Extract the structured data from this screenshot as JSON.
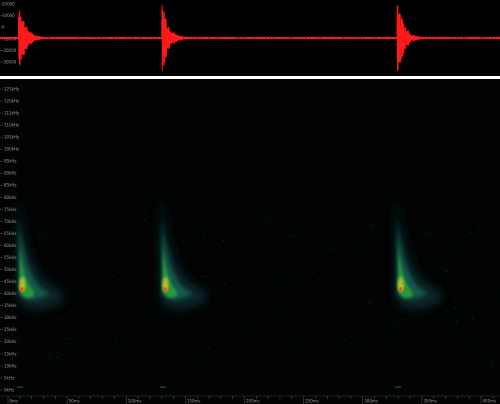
{
  "window": {
    "accent": "#ff1a1a",
    "background": "#000000",
    "divider_color": "#ffffff"
  },
  "waveform": {
    "color": "#ff1a1a",
    "amplitude_ticks": [
      "20000",
      "10000",
      "0",
      "-10000",
      "-20000",
      "-30000"
    ],
    "burst_times_ms": [
      10,
      131,
      330
    ]
  },
  "spectrogram": {
    "freq_ticks": [
      "125kHz",
      "120kHz",
      "115kHz",
      "110kHz",
      "105kHz",
      "100kHz",
      "95kHz",
      "90kHz",
      "85kHz",
      "80kHz",
      "75kHz",
      "70kHz",
      "65kHz",
      "60kHz",
      "55kHz",
      "50kHz",
      "45kHz",
      "40kHz",
      "35kHz",
      "30kHz",
      "25kHz",
      "20kHz",
      "15kHz",
      "10kHz",
      "5kHz",
      "0kHz"
    ],
    "time_ticks": [
      "0ms",
      "50ms",
      "100ms",
      "150ms",
      "200ms",
      "250ms",
      "300ms",
      "350ms",
      "400ms"
    ],
    "call_times_ms": [
      10,
      131,
      330
    ],
    "colormap": [
      "#0b2a2e",
      "#14624f",
      "#2f9a3a",
      "#9dc233",
      "#e8b01c",
      "#ff3a10"
    ]
  }
}
